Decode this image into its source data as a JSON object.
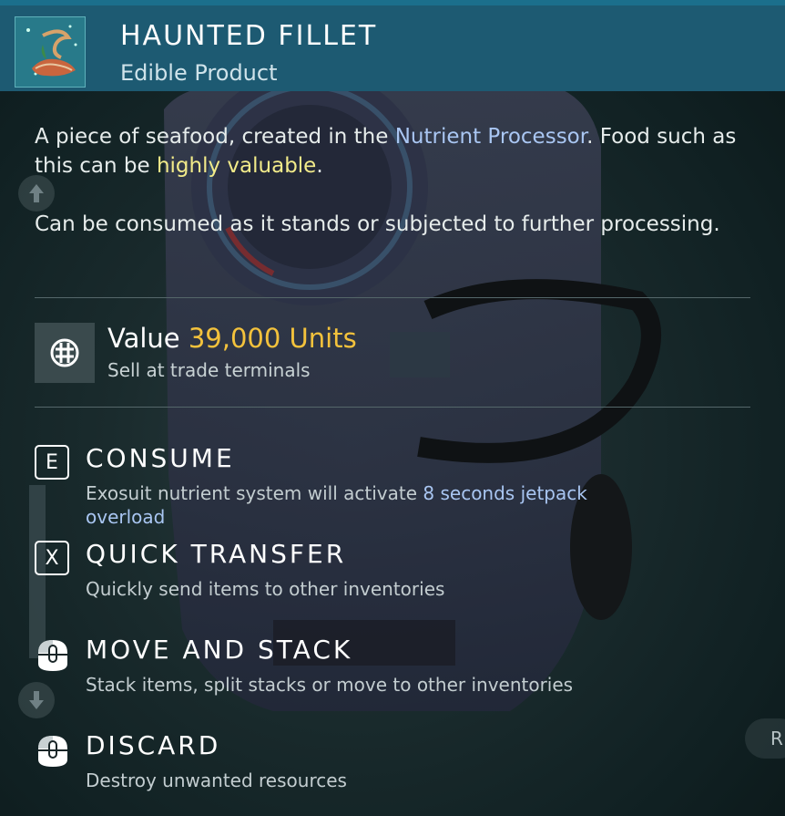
{
  "header": {
    "title": "HAUNTED FILLET",
    "subtitle": "Edible Product",
    "icon": "fish-fillet-icon"
  },
  "description": {
    "p1_a": "A piece of seafood, created in the ",
    "p1_link": "Nutrient Processor",
    "p1_b": ". Food such as this can be ",
    "p1_highlight": "highly valuable",
    "p1_c": ".",
    "p2": "Can be consumed as it stands or subjected to further processing."
  },
  "value": {
    "label": "Value",
    "amount": "39,000 Units",
    "subtitle": "Sell at trade terminals",
    "icon": "units-currency-icon"
  },
  "actions": [
    {
      "key": "E",
      "title": "CONSUME",
      "desc_a": "Exosuit nutrient system will activate ",
      "desc_highlight": "8 seconds jetpack overload"
    },
    {
      "key": "X",
      "title": "QUICK TRANSFER",
      "desc": "Quickly send items to other inventories"
    },
    {
      "key": "left-mouse-icon",
      "title": "MOVE AND STACK",
      "desc": "Stack items, split stacks or move to other inventories"
    },
    {
      "key": "left-mouse-hold-icon",
      "title": "DISCARD",
      "desc": "Destroy unwanted resources"
    }
  ],
  "edge_badge": "R",
  "colors": {
    "header_bg": "#1d5a72",
    "value_amount": "#f3c23c",
    "highlight_blue": "#a9c6f2",
    "highlight_yellow": "#f2eb8a"
  }
}
